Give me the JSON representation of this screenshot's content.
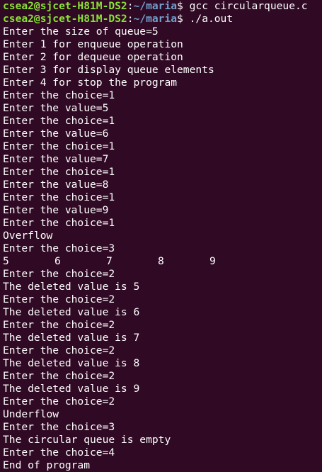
{
  "terminal": {
    "colors": {
      "background": "#300a24",
      "text": "#ffffff",
      "prompt_user": "#8ae234",
      "prompt_path": "#729fcf"
    },
    "prompts": [
      {
        "user": "csea2@sjcet-H81M-DS2",
        "colon": ":",
        "path": "~/maria",
        "symbol": "$ ",
        "command": "gcc circularqueue.c"
      },
      {
        "user": "csea2@sjcet-H81M-DS2",
        "colon": ":",
        "path": "~/maria",
        "symbol": "$ ",
        "command": "./a.out"
      }
    ],
    "output_a": [
      "Enter the size of queue=5",
      "Enter 1 for enqueue operation",
      "Enter 2 for dequeue operation",
      "Enter 3 for display queue elements",
      "Enter 4 for stop the program",
      "Enter the choice=1",
      "Enter the value=5",
      "Enter the choice=1",
      "Enter the value=6",
      "Enter the choice=1",
      "Enter the value=7",
      "Enter the choice=1",
      "Enter the value=8",
      "Enter the choice=1",
      "Enter the value=9",
      "Enter the choice=1",
      "Overflow",
      "Enter the choice=3"
    ],
    "queue_values": [
      "5",
      "6",
      "7",
      "8",
      "9"
    ],
    "output_b": [
      "Enter the choice=2",
      "The deleted value is 5",
      "Enter the choice=2",
      "The deleted value is 6",
      "Enter the choice=2",
      "The deleted value is 7",
      "Enter the choice=2",
      "The deleted value is 8",
      "Enter the choice=2",
      "The deleted value is 9",
      "Enter the choice=2",
      "Underflow",
      "Enter the choice=3",
      "The circular queue is empty",
      "Enter the choice=4",
      "End of program"
    ]
  }
}
